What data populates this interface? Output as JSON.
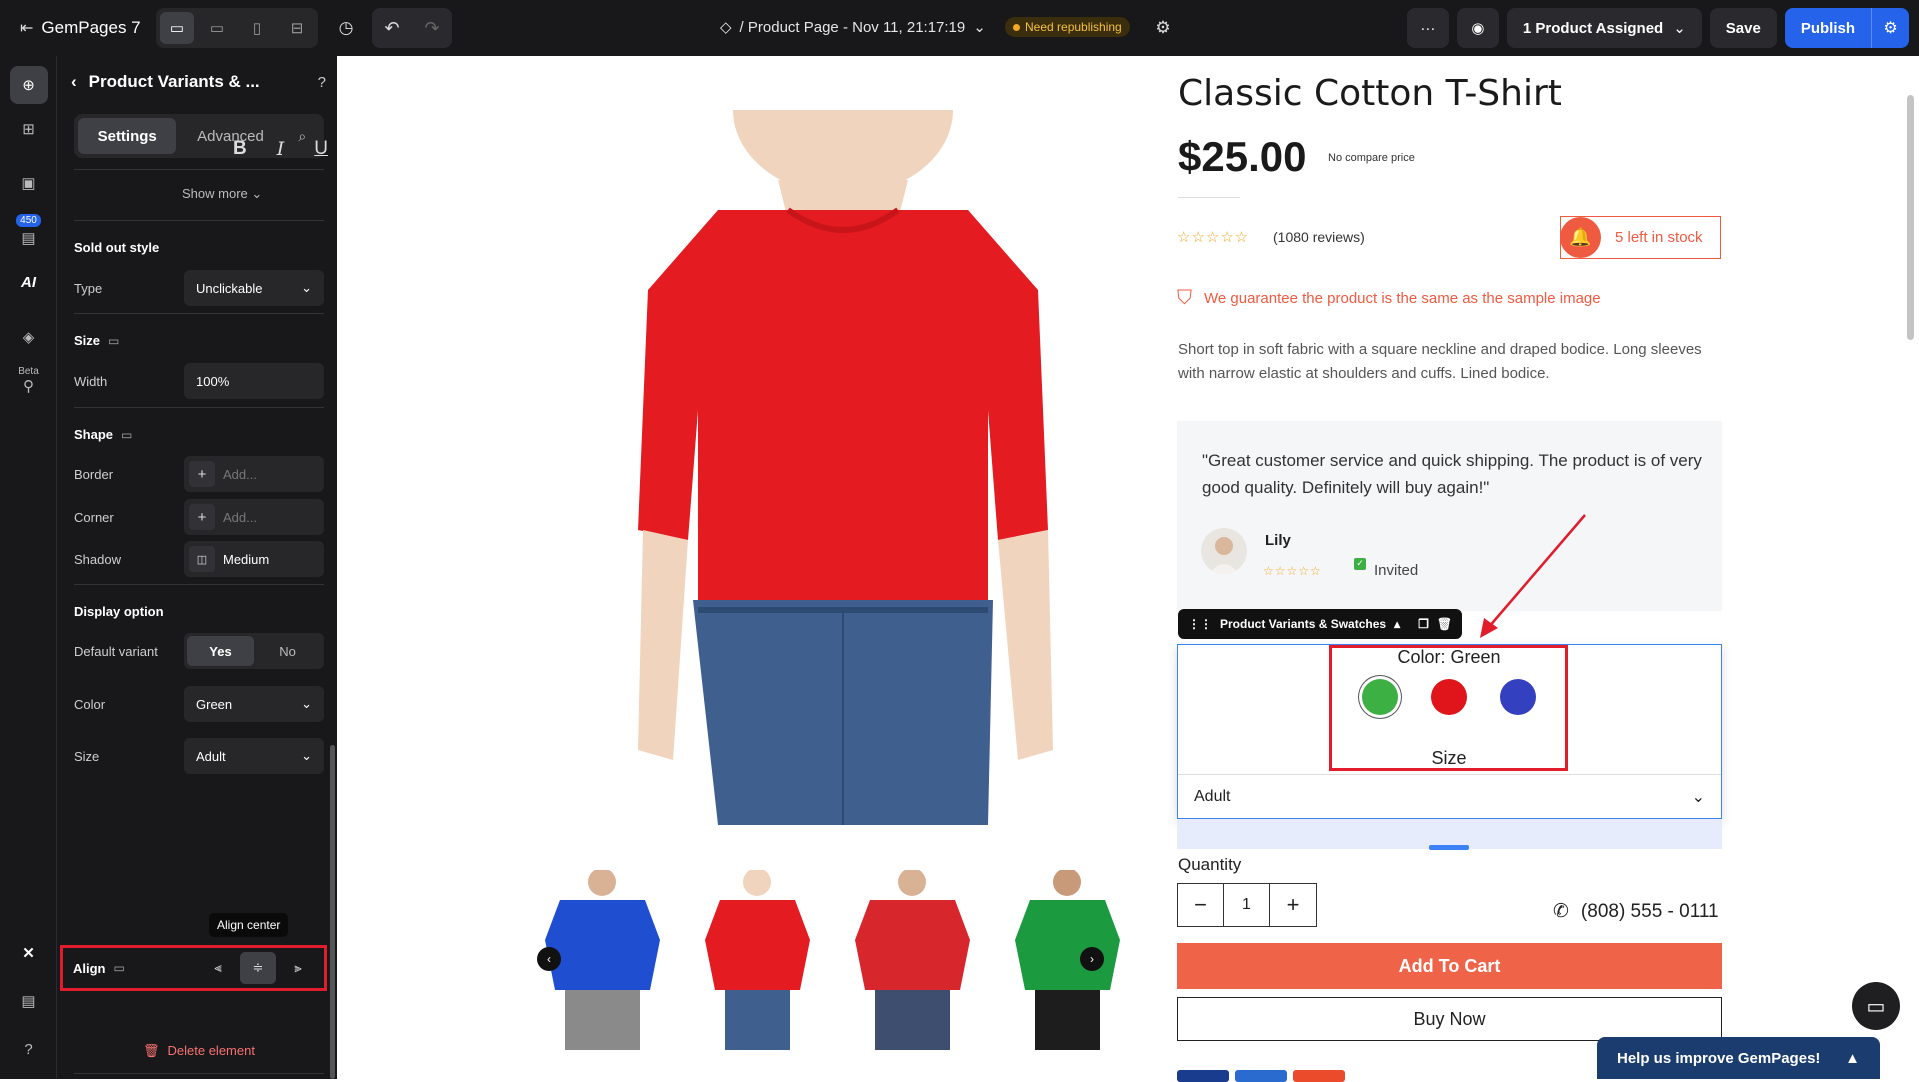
{
  "topbar": {
    "brand": "GemPages 7",
    "page_title": "/ Product Page - Nov 11, 21:17:19",
    "status_badge": "Need republishing",
    "assigned": "1 Product Assigned",
    "save_label": "Save",
    "publish_label": "Publish"
  },
  "rail": {
    "badge_count": "450",
    "ai_label": "AI",
    "beta_label": "Beta"
  },
  "panel": {
    "title": "Product Variants & ...",
    "tab_settings": "Settings",
    "tab_advanced": "Advanced",
    "show_more": "Show more",
    "sold_out_title": "Sold out style",
    "type_label": "Type",
    "type_value": "Unclickable",
    "size_title": "Size",
    "width_label": "Width",
    "width_value": "100%",
    "shape_title": "Shape",
    "border_label": "Border",
    "corner_label": "Corner",
    "add_placeholder": "Add...",
    "shadow_label": "Shadow",
    "shadow_value": "Medium",
    "display_title": "Display option",
    "default_variant_label": "Default variant",
    "yes": "Yes",
    "no": "No",
    "color_label": "Color",
    "color_value": "Green",
    "size_label": "Size",
    "size_value": "Adult",
    "align_label": "Align",
    "tooltip": "Align center",
    "delete_label": "Delete element"
  },
  "product": {
    "title": "Classic Cotton T-Shirt",
    "price": "$25.00",
    "compare": "No compare price",
    "reviews": "(1080 reviews)",
    "stock": "5 left in stock",
    "guarantee": "We guarantee the product is the same as the sample image",
    "description": "Short top in soft fabric with a square neckline and draped bodice. Long sleeves with narrow elastic at shoulders and cuffs. Lined bodice.",
    "testimonial": "\"Great customer service and quick shipping. The product is of very good quality. Definitely will buy again!\"",
    "reviewer": "Lily",
    "invited": "Invited",
    "element_bar": "Product Variants & Swatches",
    "color_label": "Color: Green",
    "size_label": "Size",
    "size_value": "Adult",
    "quantity_label": "Quantity",
    "quantity": "1",
    "phone": "(808) 555 - 0111",
    "add_to_cart": "Add To Cart",
    "buy_now": "Buy Now",
    "swatches": [
      {
        "name": "Green",
        "color": "#3cb043"
      },
      {
        "name": "Red",
        "color": "#e0141b"
      },
      {
        "name": "Blue",
        "color": "#3340c0"
      }
    ]
  },
  "help_bar": "Help us improve GemPages!",
  "colors": {
    "accent": "#2563eb",
    "brand_orange": "#ef6348",
    "annotation_red": "#e11d2c"
  }
}
